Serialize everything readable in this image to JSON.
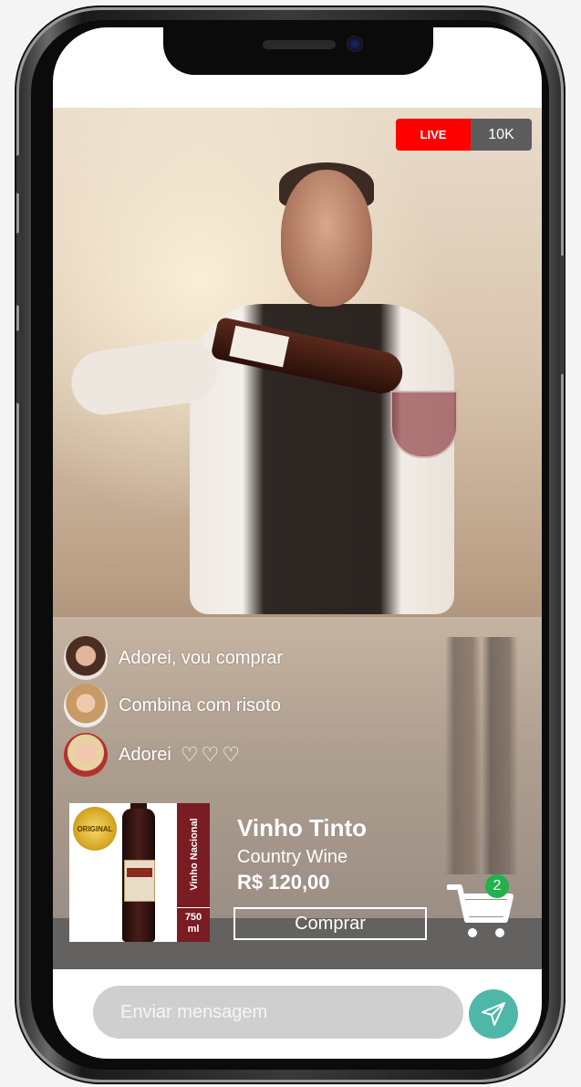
{
  "live": {
    "badge": "LIVE",
    "viewers": "10K"
  },
  "comments": [
    {
      "text": "Adorei, vou comprar",
      "avatar": "user-avatar-1"
    },
    {
      "text": "Combina com risoto",
      "avatar": "user-avatar-2"
    },
    {
      "text": "Adorei",
      "hearts": "♡♡♡",
      "avatar": "user-avatar-3"
    }
  ],
  "product": {
    "title": "Vinho Tinto",
    "subtitle": "Country Wine",
    "price": "R$ 120,00",
    "buy_label": "Comprar",
    "image_side_label": "Vinho Nacional",
    "image_volume_1": "750",
    "image_volume_2": "ml",
    "image_seal_text": "ORIGINAL"
  },
  "cart": {
    "count": "2"
  },
  "chat": {
    "placeholder": "Enviar mensagem"
  },
  "colors": {
    "live": "#ff0000",
    "badge_green": "#22b14c",
    "send_button": "#4fb7a8"
  }
}
